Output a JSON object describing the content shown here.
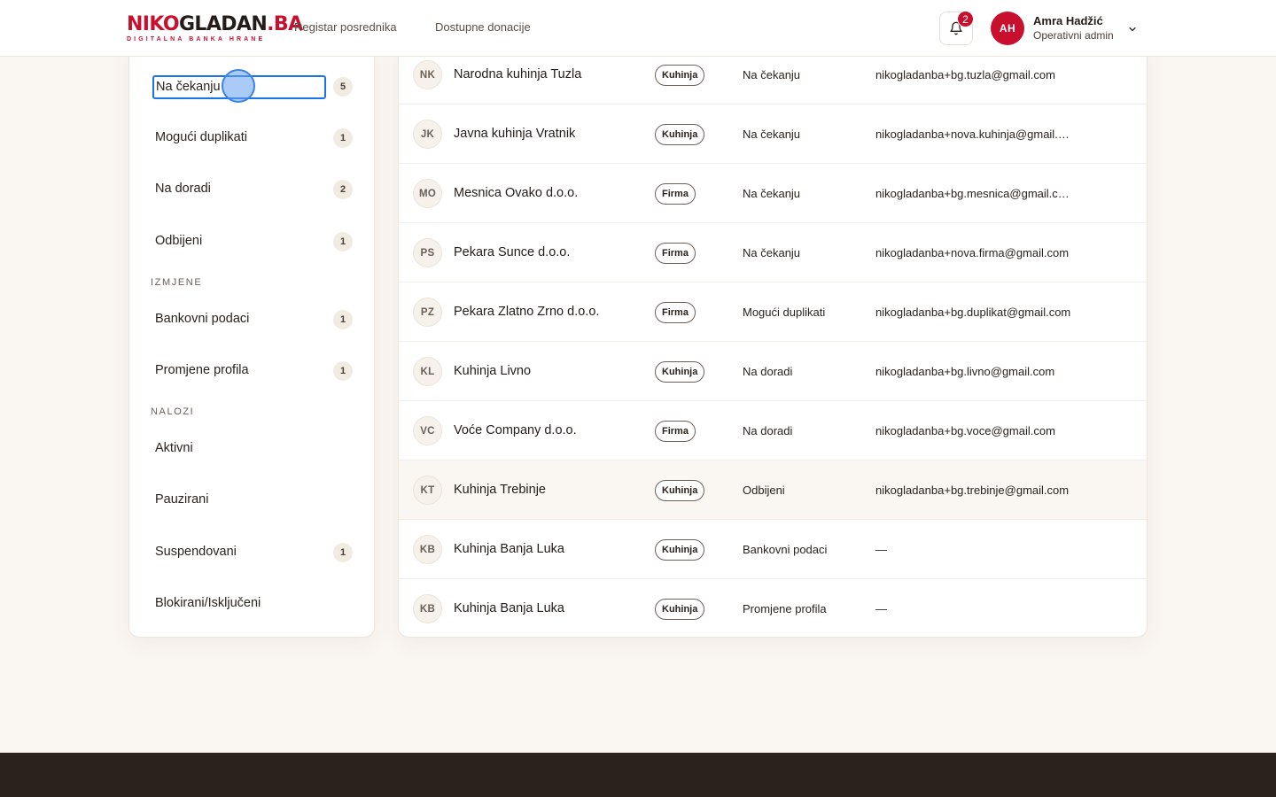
{
  "brand": {
    "logo_red_1": "NIKO",
    "logo_dark": "GLADAN",
    "logo_red_2": ".BA",
    "tagline": "DIGITALNA BANKA HRANE"
  },
  "nav": [
    {
      "label": "Registar posrednika"
    },
    {
      "label": "Dostupne donacije"
    }
  ],
  "notifications": {
    "count": "2"
  },
  "user": {
    "initials": "AH",
    "name": "Amra Hadžić",
    "role": "Operativni admin"
  },
  "sidebar": {
    "focused_item": {
      "label": "Na čekanju",
      "count": "5"
    },
    "items": [
      {
        "label": "Mogući duplikati",
        "count": "1"
      },
      {
        "label": "Na doradi",
        "count": "2"
      },
      {
        "label": "Odbijeni",
        "count": "1"
      }
    ],
    "section_izmjene": "IZMJENE",
    "izmjene": [
      {
        "label": "Bankovni podaci",
        "count": "1"
      },
      {
        "label": "Promjene profila",
        "count": "1"
      }
    ],
    "section_nalozi": "NALOZI",
    "nalozi": [
      {
        "label": "Aktivni",
        "count": ""
      },
      {
        "label": "Pauzirani",
        "count": ""
      },
      {
        "label": "Suspendovani",
        "count": "1"
      },
      {
        "label": "Blokirani/Isključeni",
        "count": ""
      }
    ]
  },
  "rows": [
    {
      "initials": "NK",
      "name": "Narodna kuhinja Tuzla",
      "type": "Kuhinja",
      "status": "Na čekanju",
      "email": "nikogladanba+bg.tuzla@gmail.com"
    },
    {
      "initials": "JK",
      "name": "Javna kuhinja Vratnik",
      "type": "Kuhinja",
      "status": "Na čekanju",
      "email": "nikogladanba+nova.kuhinja@gmail.com"
    },
    {
      "initials": "MO",
      "name": "Mesnica Ovako d.o.o.",
      "type": "Firma",
      "status": "Na čekanju",
      "email": "nikogladanba+bg.mesnica@gmail.com"
    },
    {
      "initials": "PS",
      "name": "Pekara Sunce d.o.o.",
      "type": "Firma",
      "status": "Na čekanju",
      "email": "nikogladanba+nova.firma@gmail.com"
    },
    {
      "initials": "PZ",
      "name": "Pekara Zlatno Zrno d.o.o.",
      "type": "Firma",
      "status": "Mogući duplikati",
      "email": "nikogladanba+bg.duplikat@gmail.com"
    },
    {
      "initials": "KL",
      "name": "Kuhinja Livno",
      "type": "Kuhinja",
      "status": "Na doradi",
      "email": "nikogladanba+bg.livno@gmail.com"
    },
    {
      "initials": "VC",
      "name": "Voće Company d.o.o.",
      "type": "Firma",
      "status": "Na doradi",
      "email": "nikogladanba+bg.voce@gmail.com"
    },
    {
      "initials": "KT",
      "name": "Kuhinja Trebinje",
      "type": "Kuhinja",
      "status": "Odbijeni",
      "email": "nikogladanba+bg.trebinje@gmail.com"
    },
    {
      "initials": "KB",
      "name": "Kuhinja Banja Luka",
      "type": "Kuhinja",
      "status": "Bankovni podaci",
      "email": "—"
    },
    {
      "initials": "KB",
      "name": "Kuhinja Banja Luka",
      "type": "Kuhinja",
      "status": "Promjene profila",
      "email": "—"
    }
  ]
}
